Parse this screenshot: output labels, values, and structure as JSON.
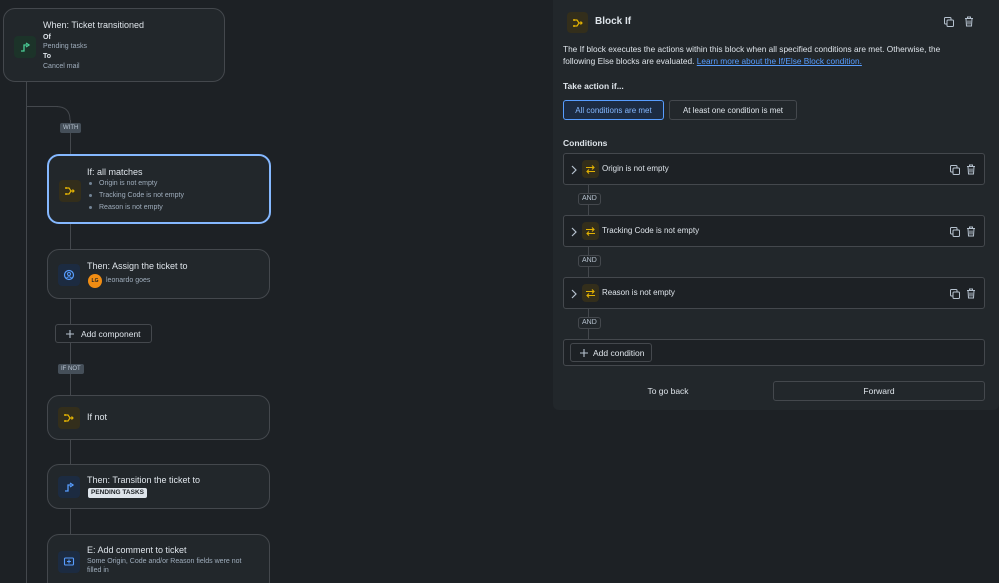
{
  "trigger": {
    "title": "When: Ticket transitioned",
    "of_label": "Of",
    "of_value": "Pending tasks",
    "to_label": "To",
    "to_value": "Cancel mail",
    "icon": "transition-icon"
  },
  "tags": {
    "with": "WITH",
    "if_not": "IF NOT"
  },
  "if_block": {
    "title": "If: all matches",
    "conditions": [
      "Origin is not empty",
      "Tracking Code is not empty",
      "Reason is not empty"
    ],
    "icon": "branch-icon"
  },
  "assign": {
    "title": "Then: Assign the ticket to",
    "avatar_initials": "LG",
    "user": "leonardo goes",
    "icon": "user-circle-icon"
  },
  "add_component": {
    "label": "Add component"
  },
  "if_not": {
    "title": "If not",
    "icon": "branch-icon"
  },
  "transition": {
    "title": "Then: Transition the ticket to",
    "status": "PENDING TASKS",
    "icon": "transition-icon"
  },
  "comment": {
    "title": "E: Add comment to ticket",
    "text_line1": "Some Origin, Code and/or Reason fields were not",
    "text_line2": "filled in",
    "icon": "comment-icon"
  },
  "panel": {
    "title": "Block If",
    "description_line1": "The If block executes the actions within this block when all specified conditions are met. Otherwise, the",
    "description_line2": "following Else blocks are evaluated.",
    "learn_more": "Learn more about the If/Else Block condition.",
    "take_action_label": "Take action if...",
    "option_all": "All conditions are met",
    "option_one": "At least one condition is met",
    "conditions_label": "Conditions",
    "conditions": [
      {
        "label": "Origin is not empty"
      },
      {
        "label": "Tracking Code is not empty"
      },
      {
        "label": "Reason is not empty"
      }
    ],
    "and_label": "AND",
    "add_condition": "Add condition",
    "back": "To go back",
    "forward": "Forward"
  },
  "colors": {
    "background": "#1d2125",
    "card": "#22272b",
    "selected_border": "#85b8ff",
    "link": "#579dff",
    "accent_yellow": "#e2b203",
    "avatar": "#f18d13"
  }
}
